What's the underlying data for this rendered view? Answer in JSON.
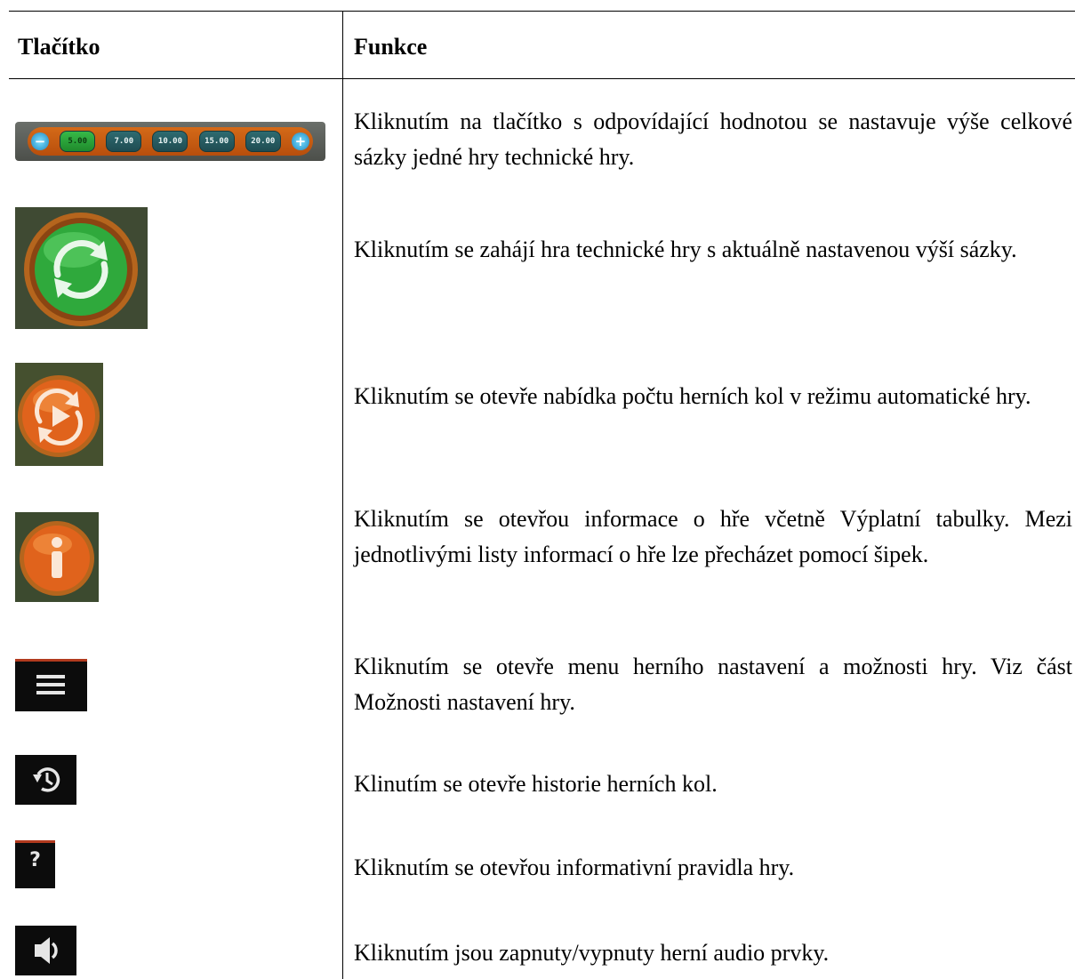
{
  "table": {
    "headers": {
      "button": "Tlačítko",
      "function": "Funkce"
    },
    "rows": [
      {
        "icon": "bet-selector-bar",
        "bet_values": [
          "5.00",
          "7.00",
          "10.00",
          "15.00",
          "20.00"
        ],
        "selected_bet": "5.00",
        "minus_symbol": "−",
        "plus_symbol": "+",
        "description": "Kliknutím na tlačítko s odpovídající hodnotou se nastavuje výše celkové sázky jedné hry technické hry."
      },
      {
        "icon": "spin-icon",
        "description": "Kliknutím se zahájí hra technické hry s aktuálně nastavenou výší sázky."
      },
      {
        "icon": "autoplay-icon",
        "description": "Kliknutím se otevře nabídka počtu herních kol v režimu automatické hry."
      },
      {
        "icon": "info-icon",
        "description": "Kliknutím se otevřou informace o hře včetně Výplatní tabulky. Mezi jednotlivými listy informací o hře lze přecházet pomocí šipek."
      },
      {
        "icon": "hamburger-menu-icon",
        "description": "Kliknutím se otevře menu herního nastavení a možnosti hry. Viz část Možnosti nastavení hry."
      },
      {
        "icon": "history-icon",
        "description": "Klinutím se otevře historie herních kol."
      },
      {
        "icon": "help-icon",
        "help_symbol": "?",
        "description": "Kliknutím se otevřou informativní pravidla hry."
      },
      {
        "icon": "speaker-icon",
        "description": "Kliknutím jsou zapnuty/vypnuty herní audio prvky."
      }
    ]
  },
  "colors": {
    "spin_green": "#2fa93c",
    "autoplay_orange": "#e0631c",
    "frame_wood": "#b5651d",
    "icon_bg": "#0c0c0c"
  }
}
